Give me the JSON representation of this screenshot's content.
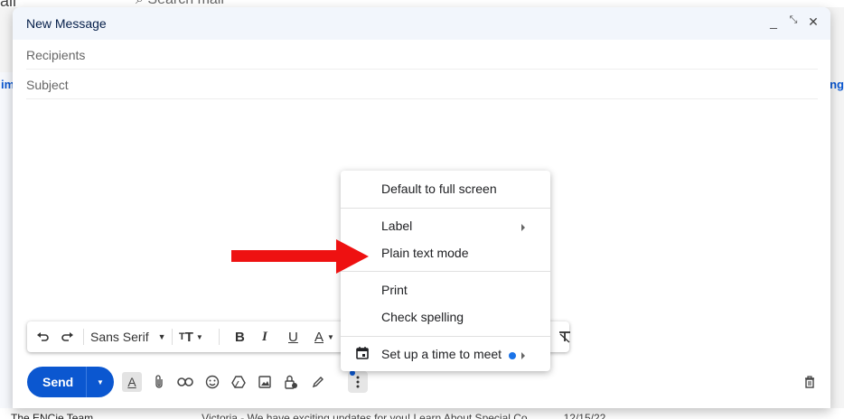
{
  "background": {
    "app_title": "ail",
    "search_placeholder": "Search mail",
    "left_tab_text": "im",
    "right_tab_text": "ng",
    "row_sender": "The ENCie Team",
    "row_snippet": "Victoria - We have exciting updates for you! Learn About Special Co",
    "row_date": "12/15/22"
  },
  "compose": {
    "title": "New Message",
    "recipients_label": "Recipients",
    "subject_label": "Subject"
  },
  "format_toolbar": {
    "font": "Sans Serif"
  },
  "send": {
    "label": "Send"
  },
  "menu": {
    "items": [
      {
        "label": "Default to full screen"
      },
      {
        "label": "Label"
      },
      {
        "label": "Plain text mode"
      },
      {
        "label": "Print"
      },
      {
        "label": "Check spelling"
      },
      {
        "label": "Set up a time to meet"
      }
    ]
  },
  "colors": {
    "accent": "#0b57d0",
    "arrow": "#ee1111",
    "header_bg": "#f2f6fc"
  }
}
